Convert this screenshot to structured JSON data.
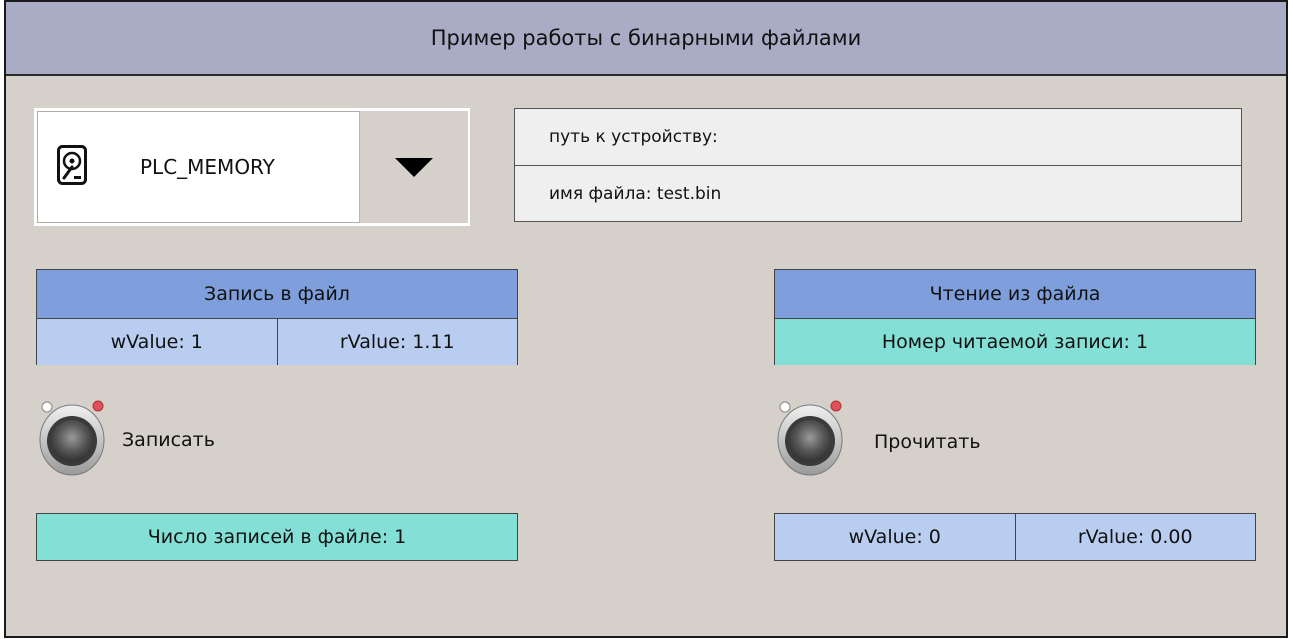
{
  "title": "Пример работы с бинарными файлами",
  "device": {
    "icon": "hard-drive-icon",
    "name": "PLC_MEMORY",
    "dropdown_icon": "triangle-down-icon"
  },
  "paths": {
    "device_path": "путь к устройству:",
    "file_name": "имя файла: test.bin"
  },
  "write": {
    "header": "Запись в файл",
    "wvalue": "wValue: 1",
    "rvalue": "rValue: 1.11",
    "button_label": "Записать",
    "record_count": "Число записей в файле: 1"
  },
  "read": {
    "header": "Чтение из файла",
    "record_number": "Номер читаемой записи: 1",
    "button_label": "Прочитать",
    "wvalue": "wValue: 0",
    "rvalue": "rValue: 0.00"
  },
  "colors": {
    "background": "#d5d0c9",
    "title_bar": "#a9acc4",
    "table_header": "#7e9fdc",
    "table_cell": "#b8cdf0",
    "teal_cell": "#84e0d6",
    "lamp_led": "#e0505a"
  }
}
